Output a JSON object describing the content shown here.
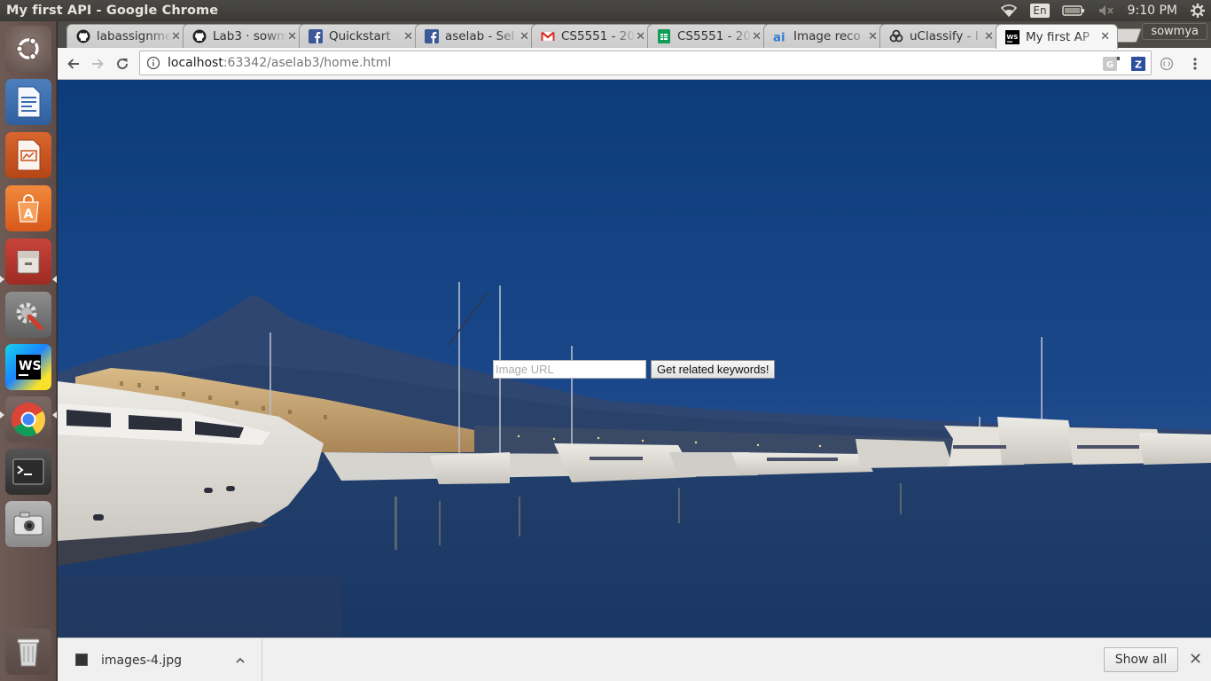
{
  "window": {
    "title": "My first API - Google Chrome"
  },
  "panel": {
    "language": "En",
    "clock": "9:10 PM",
    "indicators": [
      "wifi-icon",
      "keyboard-layout",
      "battery-icon",
      "volume-muted-icon",
      "gear-icon"
    ]
  },
  "launcher": {
    "items": [
      "ubuntu-dash",
      "libreoffice-writer",
      "libreoffice-impress",
      "ubuntu-software-center",
      "files",
      "system-settings",
      "webstorm",
      "google-chrome",
      "terminal",
      "camera",
      "trash"
    ]
  },
  "tabs": [
    {
      "label": "labassignme",
      "favicon": "github"
    },
    {
      "label": "Lab3 · sowm",
      "favicon": "github"
    },
    {
      "label": "Quickstart",
      "favicon": "facebook"
    },
    {
      "label": "aselab - Sel",
      "favicon": "facebook"
    },
    {
      "label": "CS5551 - 20",
      "favicon": "gmail"
    },
    {
      "label": "CS5551 - 20",
      "favicon": "sheets"
    },
    {
      "label": "Image reco",
      "favicon": "ai"
    },
    {
      "label": "uClassify - I",
      "favicon": "uclassify"
    },
    {
      "label": "My first AP",
      "favicon": "webstorm",
      "active": true
    }
  ],
  "profile": {
    "name": "sowmya"
  },
  "omnibox": {
    "host": "localhost",
    "path": ":63342/aselab3/home.html"
  },
  "page": {
    "input_placeholder": "Image URL",
    "input_value": "",
    "button_label": "Get related keywords!"
  },
  "downloads": {
    "file": "images-4.jpg",
    "show_all": "Show all"
  },
  "colors": {
    "sky_top": "#0f3f7d",
    "sky_bottom": "#2a4f86",
    "water": "#1d3c66",
    "panel": "#3b3a36",
    "launcher": "#6e5a55"
  }
}
